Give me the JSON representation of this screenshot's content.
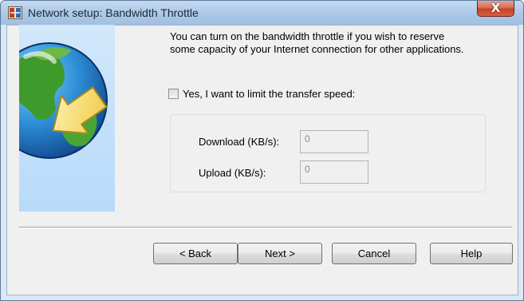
{
  "window": {
    "title": "Network setup: Bandwidth Throttle",
    "icon": "network-setup-app-icon",
    "close_icon": "close-x-icon",
    "close_glyph": "X",
    "side_image": "globe-with-arrow-illustration"
  },
  "content": {
    "description_line1": "You can turn on the bandwidth throttle if you wish to reserve",
    "description_line2": "some capacity of your Internet connection for other applications.",
    "limit_checkbox": {
      "label": "Yes, I want to limit the transfer speed:",
      "checked": false
    },
    "download": {
      "label": "Download (KB/s):",
      "value": "0",
      "enabled": false
    },
    "upload": {
      "label": "Upload (KB/s):",
      "value": "0",
      "enabled": false
    }
  },
  "buttons": {
    "back": "< Back",
    "next": "Next >",
    "cancel": "Cancel",
    "help": "Help"
  },
  "colors": {
    "title_bar": "#a9c6e6",
    "close_button": "#c1432a",
    "side_panel": "#c6e2fb",
    "dialog_background": "#f0f0f0"
  }
}
